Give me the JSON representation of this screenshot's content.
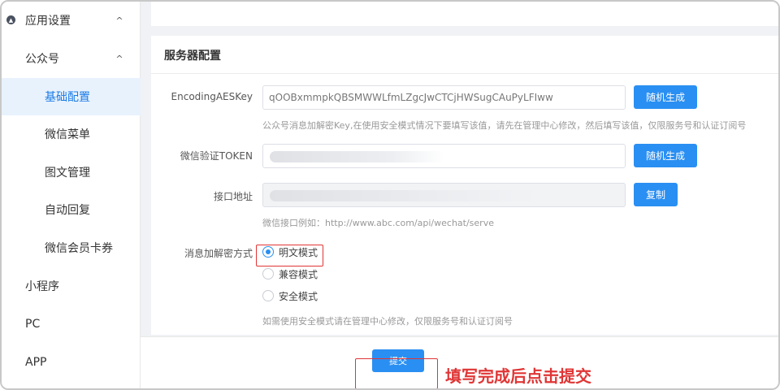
{
  "sidebar": {
    "items": [
      {
        "label": "应用设置",
        "chevron": "^",
        "level": 0
      },
      {
        "label": "公众号",
        "chevron": "^",
        "level": 1
      },
      {
        "label": "基础配置",
        "level": 2,
        "active": true
      },
      {
        "label": "微信菜单",
        "level": 2
      },
      {
        "label": "图文管理",
        "level": 2
      },
      {
        "label": "自动回复",
        "level": 2
      },
      {
        "label": "微信会员卡券",
        "level": 2
      },
      {
        "label": "小程序",
        "level": 1
      },
      {
        "label": "PC",
        "level": 1
      },
      {
        "label": "APP",
        "level": 1
      }
    ]
  },
  "panel": {
    "title": "服务器配置"
  },
  "form": {
    "aes_key": {
      "label": "EncodingAESKey",
      "value": "qOOBxmmpkQBSMWWLfmLZgcJwCTCjHWSugCAuPyLFIww",
      "button": "随机生成",
      "hint": "公众号消息加解密Key,在使用安全模式情况下要填写该值，请先在管理中心修改，然后填写该值，仅限服务号和认证订阅号"
    },
    "token": {
      "label": "微信验证TOKEN",
      "button": "随机生成"
    },
    "endpoint": {
      "label": "接口地址",
      "button": "复制",
      "hint": "微信接口例如：http://www.abc.com/api/wechat/serve"
    },
    "encryption": {
      "label": "消息加解密方式",
      "options": [
        "明文模式",
        "兼容模式",
        "安全模式"
      ],
      "selected": "明文模式",
      "hint": "如需使用安全模式请在管理中心修改，仅限服务号和认证订阅号"
    }
  },
  "footer": {
    "submit_label": "提交",
    "callout": "填写完成后点击提交"
  },
  "colors": {
    "accent": "#2a8ff2",
    "annotation": "#e03535",
    "active_bg": "#e8f2fd"
  }
}
